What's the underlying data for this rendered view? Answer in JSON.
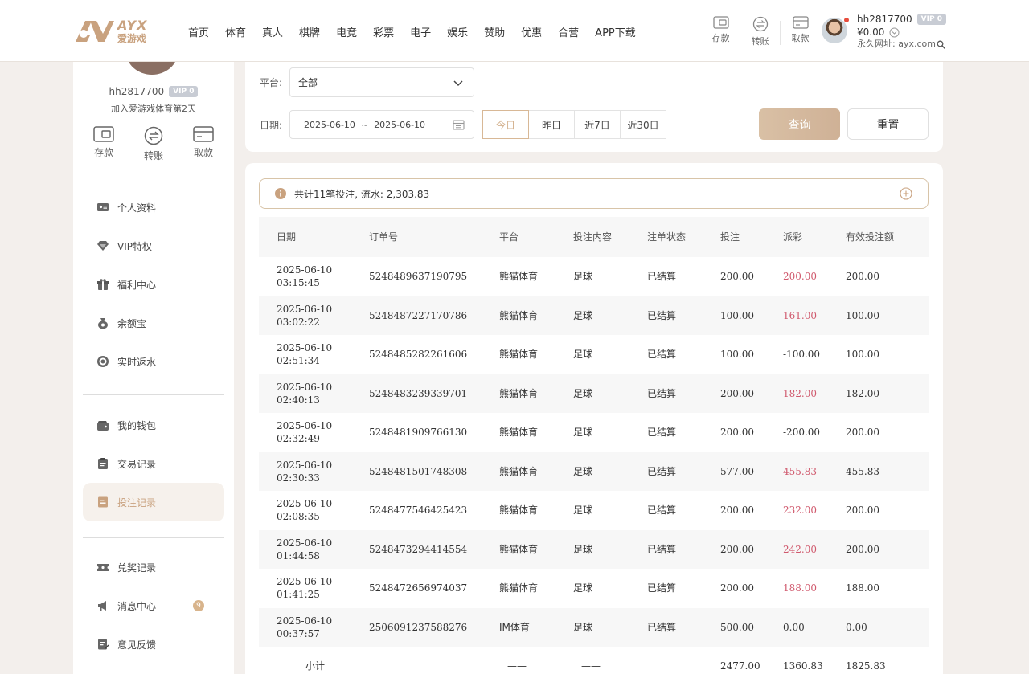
{
  "header": {
    "logo_en": "AYX",
    "logo_cn": "爱游戏",
    "nav": [
      "首页",
      "体育",
      "真人",
      "棋牌",
      "电竞",
      "彩票",
      "电子",
      "娱乐",
      "赞助",
      "优惠",
      "合营",
      "APP下载"
    ],
    "actions": [
      {
        "label": "存款",
        "icon": "deposit-card-icon"
      },
      {
        "label": "转账",
        "icon": "transfer-icon"
      },
      {
        "label": "取款",
        "icon": "withdraw-card-icon"
      }
    ],
    "user": {
      "name": "hh2817700",
      "vip": "VIP 0",
      "balance": "¥0.00",
      "url": "永久网址: ayx.com"
    }
  },
  "sidebar": {
    "username": "hh2817700",
    "vip": "VIP 0",
    "join_text": "加入爱游戏体育第2天",
    "quick": [
      {
        "label": "存款",
        "icon": "deposit-card-icon"
      },
      {
        "label": "转账",
        "icon": "transfer-icon"
      },
      {
        "label": "取款",
        "icon": "withdraw-card-icon"
      }
    ],
    "group1": [
      {
        "label": "个人资料",
        "icon": "profile-card-icon"
      },
      {
        "label": "VIP特权",
        "icon": "diamond-icon"
      },
      {
        "label": "福利中心",
        "icon": "gift-icon"
      },
      {
        "label": "余额宝",
        "icon": "money-bag-icon"
      },
      {
        "label": "实时返水",
        "icon": "rebate-icon"
      }
    ],
    "group2": [
      {
        "label": "我的钱包",
        "icon": "wallet-icon"
      },
      {
        "label": "交易记录",
        "icon": "transaction-icon"
      },
      {
        "label": "投注记录",
        "icon": "bet-record-icon",
        "active": true
      }
    ],
    "group3": [
      {
        "label": "兑奖记录",
        "icon": "ticket-icon"
      },
      {
        "label": "消息中心",
        "icon": "megaphone-icon",
        "badge": "9"
      },
      {
        "label": "意见反馈",
        "icon": "feedback-icon"
      }
    ]
  },
  "filter": {
    "platform_label": "平台:",
    "platform_value": "全部",
    "date_label": "日期:",
    "date_range": "2025-06-10  ~  2025-06-10",
    "quick_dates": [
      {
        "label": "今日",
        "active": true
      },
      {
        "label": "昨日",
        "active": false
      },
      {
        "label": "近7日",
        "active": false
      },
      {
        "label": "近30日",
        "active": false
      }
    ],
    "query_label": "查询",
    "reset_label": "重置"
  },
  "summary": {
    "text": "共计11笔投注, 流水: 2,303.83"
  },
  "table": {
    "columns": [
      "日期",
      "订单号",
      "平台",
      "投注内容",
      "注单状态",
      "投注",
      "派彩",
      "有效投注额"
    ],
    "rows": [
      {
        "date": "2025-06-10",
        "time": "03:15:45",
        "order": "5248489637190795",
        "platform": "熊猫体育",
        "content": "足球",
        "status": "已结算",
        "bet": "200.00",
        "payout": "200.00",
        "payout_positive": true,
        "valid": "200.00"
      },
      {
        "date": "2025-06-10",
        "time": "03:02:22",
        "order": "5248487227170786",
        "platform": "熊猫体育",
        "content": "足球",
        "status": "已结算",
        "bet": "100.00",
        "payout": "161.00",
        "payout_positive": true,
        "valid": "100.00"
      },
      {
        "date": "2025-06-10",
        "time": "02:51:34",
        "order": "5248485282261606",
        "platform": "熊猫体育",
        "content": "足球",
        "status": "已结算",
        "bet": "100.00",
        "payout": "-100.00",
        "payout_positive": false,
        "valid": "100.00"
      },
      {
        "date": "2025-06-10",
        "time": "02:40:13",
        "order": "5248483239339701",
        "platform": "熊猫体育",
        "content": "足球",
        "status": "已结算",
        "bet": "200.00",
        "payout": "182.00",
        "payout_positive": true,
        "valid": "182.00"
      },
      {
        "date": "2025-06-10",
        "time": "02:32:49",
        "order": "5248481909766130",
        "platform": "熊猫体育",
        "content": "足球",
        "status": "已结算",
        "bet": "200.00",
        "payout": "-200.00",
        "payout_positive": false,
        "valid": "200.00"
      },
      {
        "date": "2025-06-10",
        "time": "02:30:33",
        "order": "5248481501748308",
        "platform": "熊猫体育",
        "content": "足球",
        "status": "已结算",
        "bet": "577.00",
        "payout": "455.83",
        "payout_positive": true,
        "valid": "455.83"
      },
      {
        "date": "2025-06-10",
        "time": "02:08:35",
        "order": "5248477546425423",
        "platform": "熊猫体育",
        "content": "足球",
        "status": "已结算",
        "bet": "200.00",
        "payout": "232.00",
        "payout_positive": true,
        "valid": "200.00"
      },
      {
        "date": "2025-06-10",
        "time": "01:44:58",
        "order": "5248473294414554",
        "platform": "熊猫体育",
        "content": "足球",
        "status": "已结算",
        "bet": "200.00",
        "payout": "242.00",
        "payout_positive": true,
        "valid": "200.00"
      },
      {
        "date": "2025-06-10",
        "time": "01:41:25",
        "order": "5248472656974037",
        "platform": "熊猫体育",
        "content": "足球",
        "status": "已结算",
        "bet": "200.00",
        "payout": "188.00",
        "payout_positive": true,
        "valid": "188.00"
      },
      {
        "date": "2025-06-10",
        "time": "00:37:57",
        "order": "2506091237588276",
        "platform": "IM体育",
        "content": "足球",
        "status": "已结算",
        "bet": "500.00",
        "payout": "0.00",
        "payout_positive": false,
        "valid": "0.00"
      }
    ],
    "subtotal": {
      "label": "小计",
      "platform": "——",
      "content": "——",
      "bet": "2477.00",
      "payout": "1360.83",
      "valid": "1825.83"
    }
  },
  "colors": {
    "accent": "#c9a27f",
    "positive_payout": "#d0596d",
    "badge": "#d8b48c"
  }
}
